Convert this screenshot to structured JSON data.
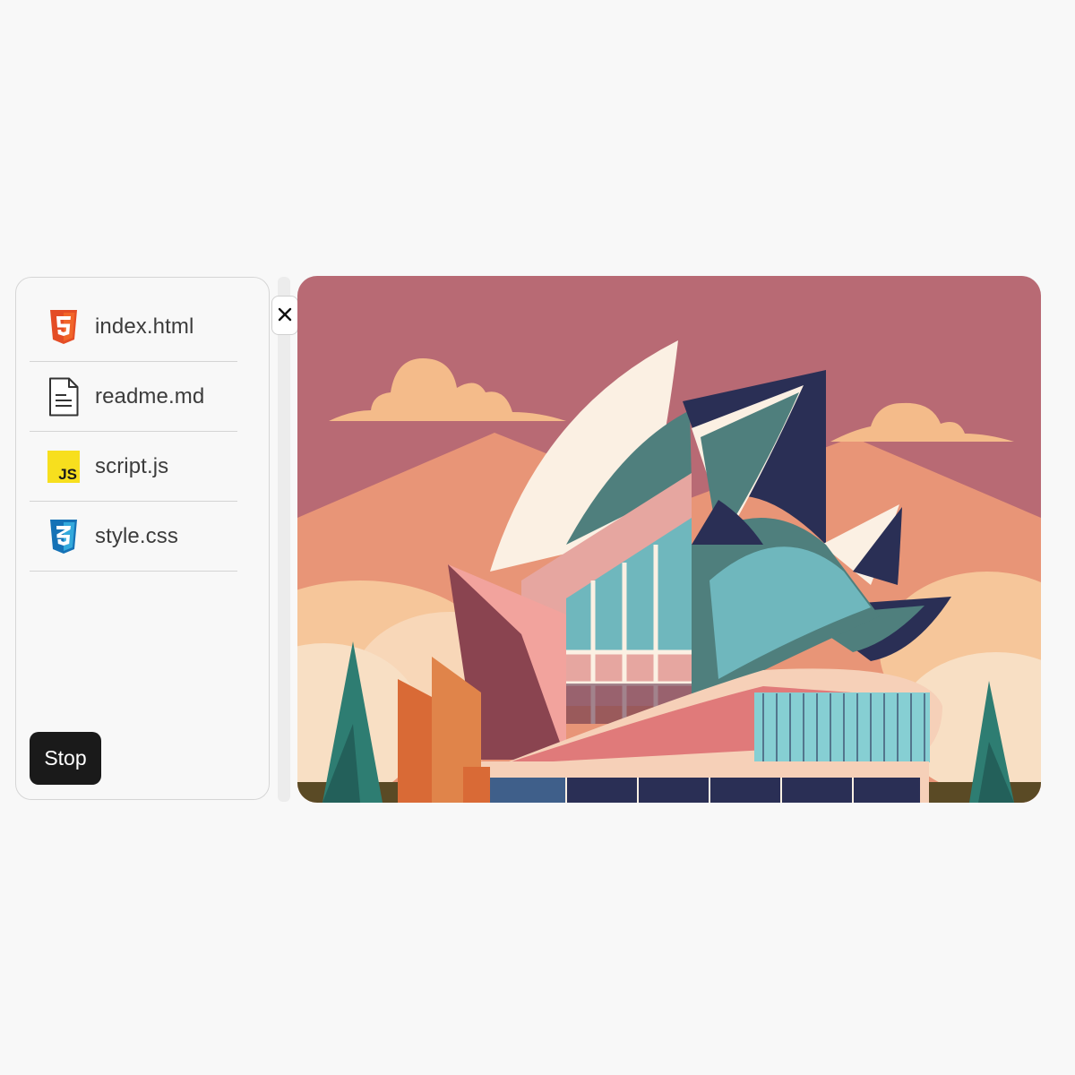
{
  "files": [
    {
      "name": "index.html",
      "icon": "html5-icon"
    },
    {
      "name": "readme.md",
      "icon": "document-icon"
    },
    {
      "name": "script.js",
      "icon": "javascript-icon"
    },
    {
      "name": "style.css",
      "icon": "css3-icon"
    }
  ],
  "stop_button": {
    "label": "Stop"
  },
  "close_button": {
    "icon": "close-icon"
  },
  "preview": {
    "subject": "opera-house-illustration",
    "colors": {
      "sky": "#b86a74",
      "mountain": "#e89577",
      "cloud": "#f4bb8a",
      "sail_light": "#fbf0e3",
      "teal": "#4f7f7d",
      "navy": "#2a2f55",
      "pink": "#e07a7a",
      "tree": "#2e7d72"
    }
  },
  "brand_colors": {
    "html": "#e44d26",
    "js": "#f7df1e",
    "css": "#1572b6",
    "stop": "#1a1a1a"
  }
}
